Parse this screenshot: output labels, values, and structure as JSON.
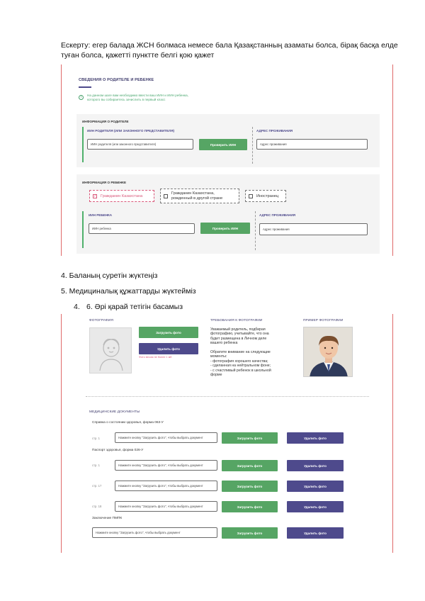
{
  "intro_note": "Ескерту: егер балада ЖСН болмаса немесе бала Қазақстанның азаматы болса, бірақ басқа елде туған болса, қажетті пунктте белгі қою қажет",
  "steps": {
    "step4": "4. Баланың суретін жүктеңіз",
    "step5": "5. Медициналық құжаттарды жүктейміз",
    "step6_num": "4.",
    "step6": "6. Әрі қарай тетігін басамыз"
  },
  "screen1": {
    "section_title": "СВЕДЕНИЯ О РОДИТЕЛЕ И РЕБЕНКЕ",
    "info_icon": "info-icon",
    "info_line1": "На данном шаге вам необходимо ввести ваш ИИН и ИИН ребенка,",
    "info_line2": "которого вы собираетесь зачислить в первый класс",
    "parent": {
      "panel_title": "ИНФОРМАЦИЯ О РОДИТЕЛЕ",
      "iin_label": "ИИН РОДИТЕЛЯ (ИЛИ ЗАКОННОГО ПРЕДСТАВИТЕЛЯ)",
      "iin_placeholder": "ИИН родителя (или законного представителя)",
      "check_button": "Проверить ИИН",
      "address_label": "АДРЕС ПРОЖИВАНИЯ",
      "address_placeholder": "Адрес проживания"
    },
    "child": {
      "panel_title": "ИНФОРМАЦИЯ О РЕБЕНКЕ",
      "options": [
        {
          "label": "Гражданин Казахстана",
          "checked": true
        },
        {
          "label_line1": "Гражданин Казахстана,",
          "label_line2": "рожденный в другой стране",
          "checked": false
        },
        {
          "label": "Иностранец",
          "checked": false
        }
      ],
      "iin_label": "ИИН РЕБЕНКА",
      "iin_placeholder": "ИИН ребенка",
      "check_button": "Проверить ИИН",
      "address_label": "АДРЕС ПРОЖИВАНИЯ",
      "address_placeholder": "Адрес проживания"
    },
    "colors": {
      "accent": "#4e4a8c",
      "green": "#56a564",
      "red_line": "#e06a6a",
      "selected": "#d9587a"
    }
  },
  "screen2": {
    "photo_header": "ФОТОГРАФИЯ",
    "upload_button": "Загрузить фото",
    "delete_button": "Удалить фото",
    "photo_hint": "Фото весом не более 1 мб",
    "req_header": "ТРЕБОВАНИЯ К ФОТОГРАФИИ",
    "req_lines": [
      "Уважаемый родитель, подбирая",
      "фотографию, учитывайте, что она",
      "будет размещена в Личном деле",
      "вашего ребенка",
      "",
      "Обратите внимание на следующие",
      "моменты:",
      "- фотография хорошего качества;",
      "- сделанная на нейтральном фоне;",
      "- с счастливый ребенок в школьной",
      "форме"
    ],
    "example_header": "ПРИМЕР ФОТОГРАФИИ",
    "med_header": "МЕДИЦИНСКИЕ ДОКУМЕНТЫ",
    "doc_063": "Справка о состоянии здоровья, форма 063-У",
    "doc_026": "Паспорт здоровья, форма 026-У",
    "doc_pmpk": "Заключение ПМПК",
    "file_placeholder": "Нажмите кнопку \"Загрузить фото\", чтобы выбрать документ",
    "rows": [
      {
        "page": "стр. 1"
      },
      {
        "page": "стр. 1"
      },
      {
        "page": "стр. 17"
      },
      {
        "page": "стр. 18"
      },
      {
        "page": ""
      }
    ]
  }
}
